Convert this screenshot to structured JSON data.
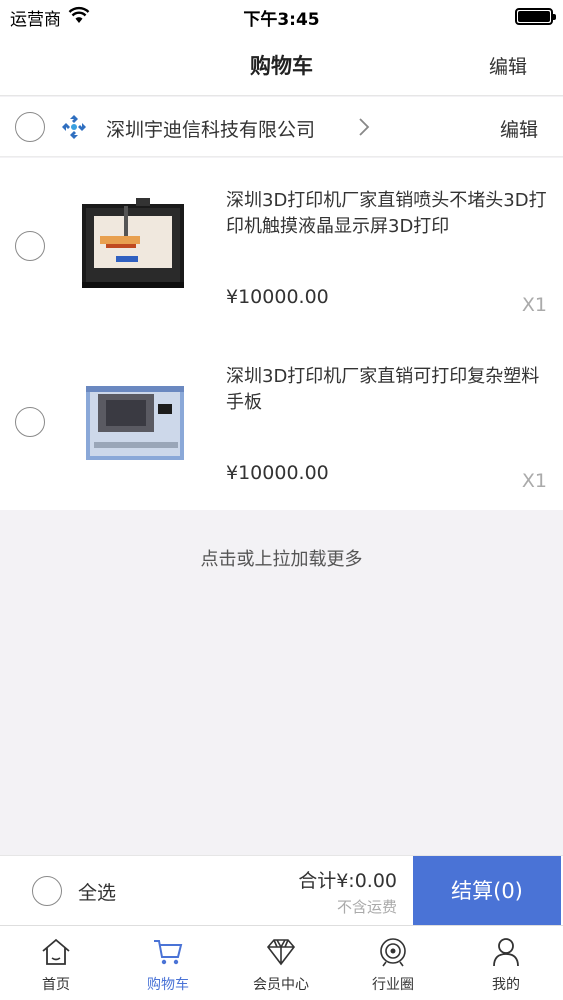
{
  "status_bar": {
    "carrier": "运营商",
    "time": "下午3:45"
  },
  "nav": {
    "title": "购物车",
    "edit_label": "编辑"
  },
  "shop": {
    "name": "深圳宇迪信科技有限公司",
    "edit_label": "编辑"
  },
  "products": [
    {
      "name": "深圳3D打印机厂家直销喷头不堵头3D打印机触摸液晶显示屏3D打印",
      "price": "¥10000.00",
      "qty": "X1"
    },
    {
      "name": "深圳3D打印机厂家直销可打印复杂塑料手板",
      "price": "¥10000.00",
      "qty": "X1"
    }
  ],
  "load_more": "点击或上拉加载更多",
  "checkout": {
    "select_all": "全选",
    "total": "合计¥:0.00",
    "shipping_note": "不含运费",
    "button": "结算(0)"
  },
  "tabs": [
    {
      "label": "首页",
      "icon": "home-icon"
    },
    {
      "label": "购物车",
      "icon": "cart-icon"
    },
    {
      "label": "会员中心",
      "icon": "diamond-icon"
    },
    {
      "label": "行业圈",
      "icon": "target-icon"
    },
    {
      "label": "我的",
      "icon": "user-icon"
    }
  ],
  "colors": {
    "accent": "#4a73d6",
    "background": "#f3f2f5"
  }
}
